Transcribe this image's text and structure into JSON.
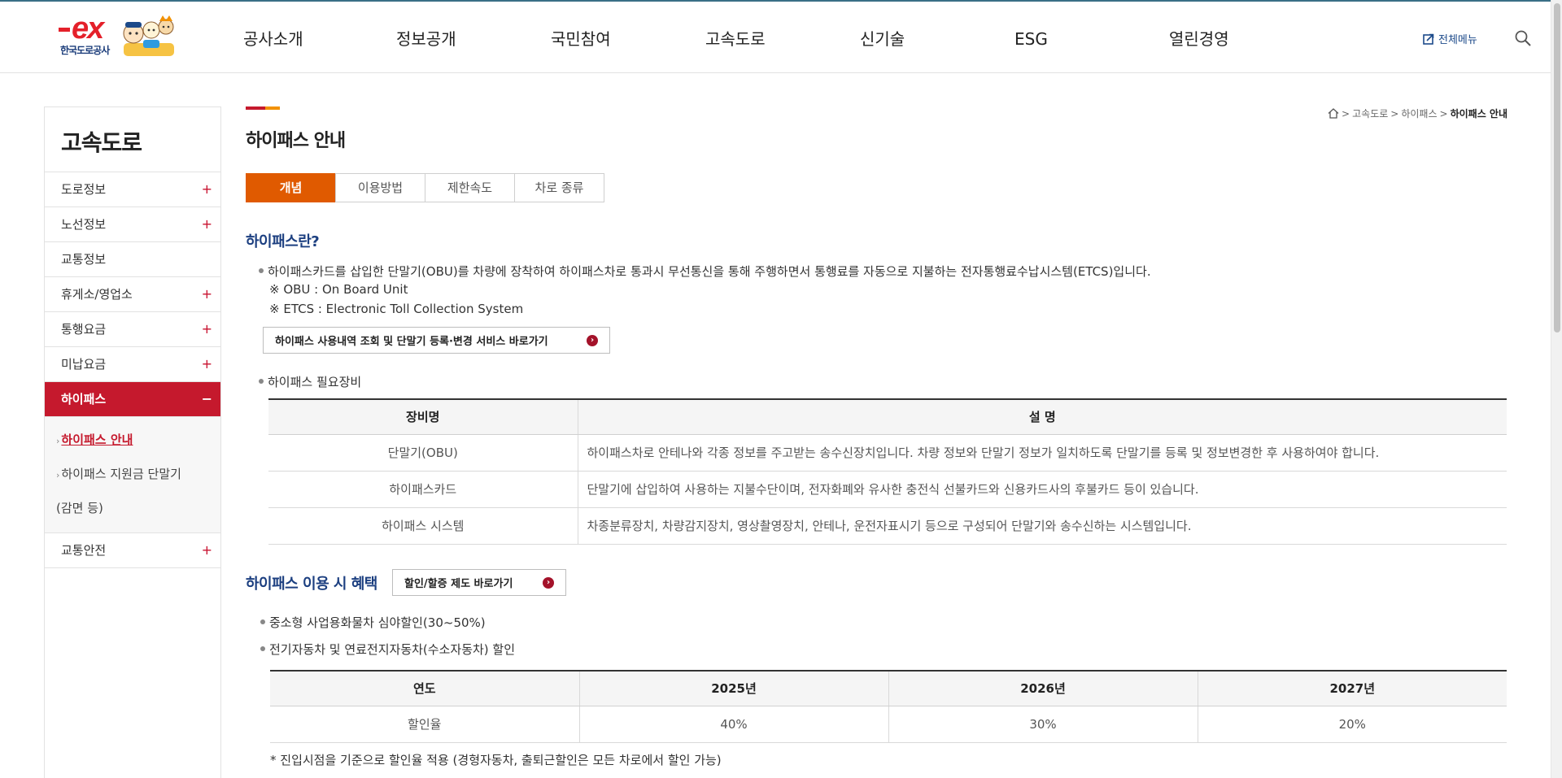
{
  "header": {
    "logo_text": "ex",
    "logo_subtitle": "한국도로공사",
    "nav": [
      "공사소개",
      "정보공개",
      "국민참여",
      "고속도로",
      "신기술",
      "ESG",
      "열린경영"
    ],
    "all_menu_label": "전체메뉴",
    "all_menu_icon": "external-edit-icon",
    "search_icon": "search-icon"
  },
  "sidebar": {
    "title": "고속도로",
    "items": [
      {
        "label": "도로정보",
        "toggle": "+"
      },
      {
        "label": "노선정보",
        "toggle": "+"
      },
      {
        "label": "교통정보",
        "toggle": ""
      },
      {
        "label": "휴게소/영업소",
        "toggle": "+"
      },
      {
        "label": "통행요금",
        "toggle": "+"
      },
      {
        "label": "미납요금",
        "toggle": "+"
      },
      {
        "label": "하이패스",
        "toggle": "−"
      },
      {
        "label": "교통안전",
        "toggle": "+"
      }
    ],
    "sub_items": [
      "하이패스 안내",
      "하이패스 지원금 단말기",
      "(감면 등)"
    ],
    "sub_arrow": "›"
  },
  "breadcrumb": {
    "sep": ">",
    "items": [
      "고속도로",
      "하이패스"
    ],
    "current": "하이패스 안내"
  },
  "page_title": "하이패스 안내",
  "tabs": [
    "개념",
    "이용방법",
    "제한속도",
    "차로 종류"
  ],
  "section1": {
    "heading": "하이패스란?",
    "desc": "하이패스카드를 삽입한 단말기(OBU)를 차량에 장착하여 하이패스차로 통과시 무선통신을 통해 주행하면서 통행료를 자동으로 지불하는 전자통행료수납시스템(ETCS)입니다.",
    "note1": "※ OBU : On Board Unit",
    "note2": "※ ETCS : Electronic Toll Collection System",
    "link_button": "하이패스 사용내역 조회 및 단말기 등록·변경 서비스 바로가기",
    "equipment_label": "하이패스 필요장비",
    "table_headers": [
      "장비명",
      "설 명"
    ],
    "table_rows": [
      [
        "단말기(OBU)",
        "하이패스차로 안테나와 각종 정보를 주고받는 송수신장치입니다. 차량 정보와 단말기 정보가 일치하도록 단말기를 등록 및 정보변경한 후 사용하여야 합니다."
      ],
      [
        "하이패스카드",
        "단말기에 삽입하여 사용하는 지불수단이며, 전자화폐와 유사한 충전식 선불카드와 신용카드사의 후불카드 등이 있습니다."
      ],
      [
        "하이패스 시스템",
        "차종분류장치, 차량감지장치, 영상촬영장치, 안테나, 운전자표시기 등으로 구성되어 단말기와 송수신하는 시스템입니다."
      ]
    ]
  },
  "section2": {
    "heading": "하이패스 이용 시 혜택",
    "link_button": "할인/할증 제도 바로가기",
    "bullet1": "중소형 사업용화물차 심야할인(30~50%)",
    "bullet2": "전기자동차 및 연료전지자동차(수소자동차) 할인",
    "table_headers": [
      "연도",
      "2025년",
      "2026년",
      "2027년"
    ],
    "table_row": [
      "할인율",
      "40%",
      "30%",
      "20%"
    ],
    "footnote": "* 진입시점을 기준으로 할인율 적용 (경형자동차, 출퇴근할인은 모든 차로에서 할인 가능)"
  },
  "colors": {
    "accent_red": "#c5192d",
    "tab_orange": "#e05a00",
    "heading_blue": "#1c3f80"
  }
}
